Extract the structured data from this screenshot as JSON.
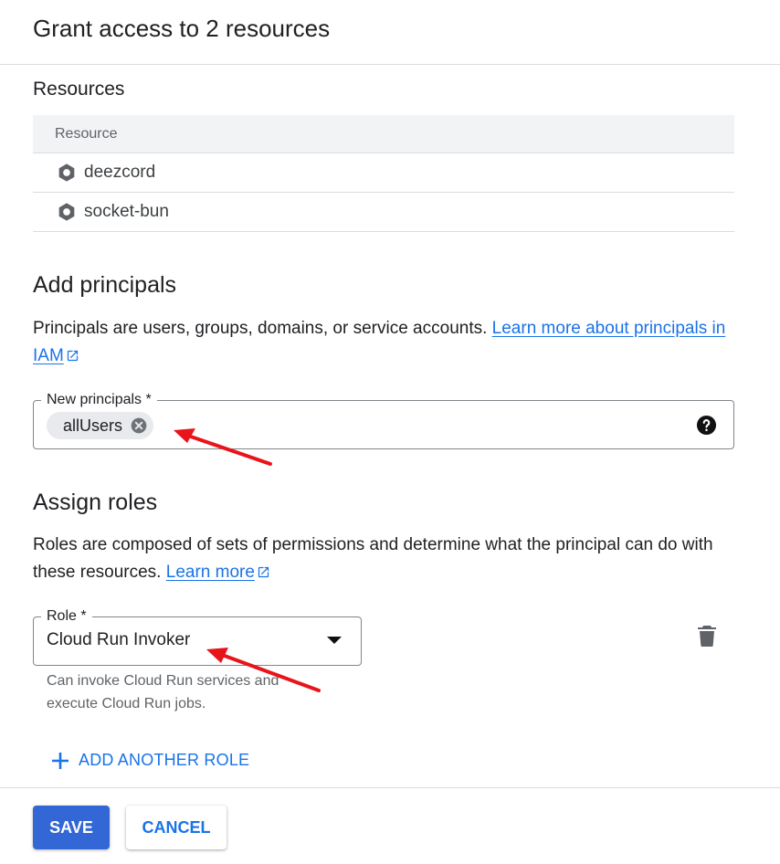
{
  "dialog": {
    "title": "Grant access to 2 resources"
  },
  "resources": {
    "heading": "Resources",
    "column_header": "Resource",
    "rows": [
      {
        "name": "deezcord",
        "icon": "cloud-run-service-icon"
      },
      {
        "name": "socket-bun",
        "icon": "cloud-run-service-icon"
      }
    ]
  },
  "principals": {
    "heading": "Add principals",
    "description": "Principals are users, groups, domains, or service accounts.",
    "link_text": "Learn more about principals in IAM",
    "field_label": "New principals *",
    "chips": [
      "allUsers"
    ]
  },
  "roles": {
    "heading": "Assign roles",
    "description": "Roles are composed of sets of permissions and determine what the principal can do with these resources.",
    "link_text": "Learn more",
    "field_label": "Role *",
    "selected_role": "Cloud Run Invoker",
    "role_hint": "Can invoke Cloud Run services and execute Cloud Run jobs.",
    "add_another_label": "ADD ANOTHER ROLE"
  },
  "footer": {
    "save_label": "SAVE",
    "cancel_label": "CANCEL"
  },
  "colors": {
    "accent": "#1a73e8",
    "save_bg": "#3367d6",
    "annotation": "#e8141b"
  }
}
